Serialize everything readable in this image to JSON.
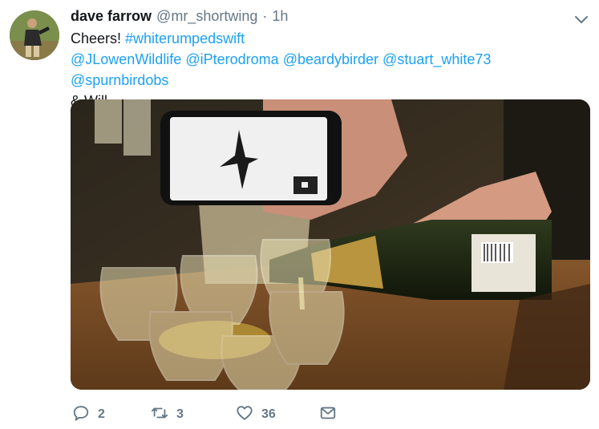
{
  "tweet": {
    "author": {
      "display_name": "dave farrow",
      "handle": "@mr_shortwing",
      "separator": "·",
      "time": "1h"
    },
    "text": {
      "line1_prefix": "Cheers! ",
      "hashtag": "#whiterumpedswift",
      "mentions": [
        "@JLowenWildlife",
        "@iPterodroma",
        "@beardybirder",
        "@stuart_white73",
        "@spurnbirdobs"
      ],
      "line3": "& Will."
    },
    "actions": {
      "reply_count": "2",
      "retweet_count": "3",
      "like_count": "36"
    },
    "icons": {
      "menu": "chevron-down-icon",
      "reply": "reply-icon",
      "retweet": "retweet-icon",
      "like": "heart-icon",
      "dm": "envelope-icon"
    },
    "colors": {
      "link": "#1da1f2",
      "muted": "#657786",
      "text": "#14171a"
    }
  }
}
